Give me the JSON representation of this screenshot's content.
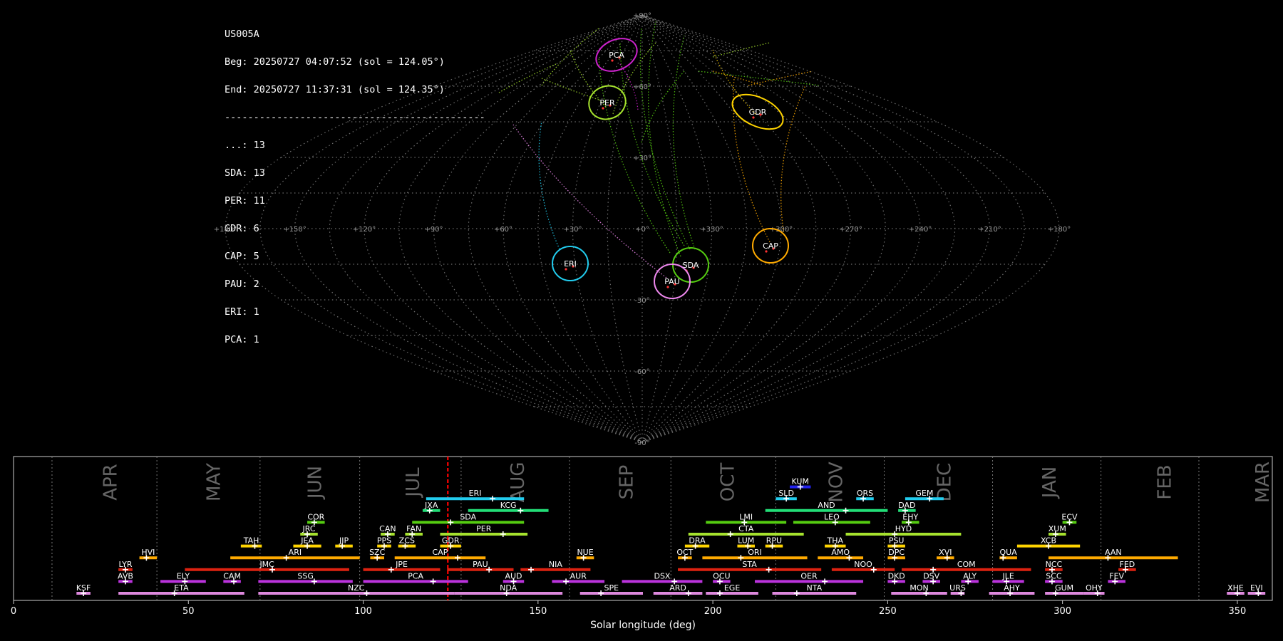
{
  "info_block": {
    "station": "US005A",
    "begin": "Beg: 20250727 04:07:52 (sol = 124.05°)",
    "end": "End: 20250727 11:37:31 (sol = 124.35°)",
    "separator": "---------------------------------------------",
    "counts": [
      {
        "label": "...: 13"
      },
      {
        "label": "SDA: 13"
      },
      {
        "label": "PER: 11"
      },
      {
        "label": "GDR: 6"
      },
      {
        "label": "CAP: 5"
      },
      {
        "label": "PAU: 2"
      },
      {
        "label": "ERI: 1"
      },
      {
        "label": "PCA: 1"
      }
    ]
  },
  "sky_map": {
    "projection": "sinusoidal",
    "lon_tick_labels": [
      "+180°",
      "+150°",
      "+120°",
      "+90°",
      "+60°",
      "+30°",
      "+0°",
      "+330°",
      "+300°",
      "+270°",
      "+240°",
      "+210°",
      "+180°"
    ],
    "lat_tick_labels": [
      "+90°",
      "+60°",
      "+30°",
      "-30°",
      "-60°",
      "-90°"
    ],
    "radiants": [
      {
        "name": "PCA",
        "color": "#cc22cc",
        "lon": -30,
        "lat": 71
      },
      {
        "name": "PER",
        "color": "#a6e22e",
        "lon": -45,
        "lat": 57
      },
      {
        "name": "GDR",
        "color": "#ffd400",
        "lon": -270,
        "lat": 51
      },
      {
        "name": "ERI",
        "color": "#22ccee",
        "lon": -105,
        "lat": -10
      },
      {
        "name": "SDA",
        "color": "#55cc11",
        "lon": -40,
        "lat": -12
      },
      {
        "name": "CAP",
        "color": "#ffaa00",
        "lon": -120,
        "lat": -5
      },
      {
        "name": "PAU",
        "color": "#ee88ee",
        "lon": -35,
        "lat": -17
      }
    ]
  },
  "chart_data": {
    "type": "timeline",
    "xlabel": "Solar longitude (deg)",
    "xlim": [
      0,
      360
    ],
    "x_ticks": [
      0,
      50,
      100,
      150,
      200,
      250,
      300,
      350
    ],
    "current_sol": 124.2,
    "months": [
      {
        "label": "APR",
        "center": 24.5,
        "start": 11
      },
      {
        "label": "MAY",
        "center": 54,
        "start": 41
      },
      {
        "label": "JUN",
        "center": 83,
        "start": 70.5
      },
      {
        "label": "JUL",
        "center": 111,
        "start": 99
      },
      {
        "label": "AUG",
        "center": 141,
        "start": 128
      },
      {
        "label": "SEP",
        "center": 172,
        "start": 159
      },
      {
        "label": "OCT",
        "center": 201,
        "start": 188
      },
      {
        "label": "NOV",
        "center": 232,
        "start": 218
      },
      {
        "label": "DEC",
        "center": 263,
        "start": 249
      },
      {
        "label": "JAN",
        "center": 293,
        "start": 280
      },
      {
        "label": "FEB",
        "center": 326,
        "start": 311
      },
      {
        "label": "MAR",
        "center": 354,
        "start": 339
      }
    ],
    "showers": [
      {
        "name": "KSF",
        "start": 18,
        "end": 22,
        "peak": 20,
        "row": 0,
        "color": "#dd88dd"
      },
      {
        "name": "ETA",
        "start": 30,
        "end": 66,
        "peak": 46,
        "row": 0,
        "color": "#dd88dd"
      },
      {
        "name": "NZC",
        "start": 70,
        "end": 126,
        "peak": 101,
        "row": 0,
        "color": "#dd88dd"
      },
      {
        "name": "NDA",
        "start": 126,
        "end": 157,
        "peak": 141,
        "row": 0,
        "color": "#dd88dd"
      },
      {
        "name": "SPE",
        "start": 162,
        "end": 180,
        "peak": 168,
        "row": 0,
        "color": "#dd88dd"
      },
      {
        "name": "ARD",
        "start": 183,
        "end": 197,
        "peak": 193,
        "row": 0,
        "color": "#dd88dd"
      },
      {
        "name": "EGE",
        "start": 198,
        "end": 213,
        "peak": 202,
        "row": 0,
        "color": "#dd88dd"
      },
      {
        "name": "NTA",
        "start": 217,
        "end": 241,
        "peak": 224,
        "row": 0,
        "color": "#dd88dd"
      },
      {
        "name": "MON",
        "start": 251,
        "end": 267,
        "peak": 261,
        "row": 0,
        "color": "#dd88dd"
      },
      {
        "name": "URS",
        "start": 268,
        "end": 272,
        "peak": 271,
        "row": 0,
        "color": "#dd88dd"
      },
      {
        "name": "AHY",
        "start": 279,
        "end": 292,
        "peak": 285,
        "row": 0,
        "color": "#dd88dd"
      },
      {
        "name": "GUM",
        "start": 295,
        "end": 306,
        "peak": 298,
        "row": 0,
        "color": "#dd88dd"
      },
      {
        "name": "OHY",
        "start": 306,
        "end": 312,
        "peak": 310,
        "row": 0,
        "color": "#dd88dd"
      },
      {
        "name": "XHE",
        "start": 347,
        "end": 352,
        "peak": 350,
        "row": 0,
        "color": "#dd88dd"
      },
      {
        "name": "EVI",
        "start": 353,
        "end": 358,
        "peak": 356,
        "row": 0,
        "color": "#dd88dd"
      },
      {
        "name": "AVB",
        "start": 30,
        "end": 34,
        "peak": 32,
        "row": 1,
        "color": "#bb33dd"
      },
      {
        "name": "ELY",
        "start": 42,
        "end": 55,
        "peak": 49,
        "row": 1,
        "color": "#bb33dd"
      },
      {
        "name": "CAM",
        "start": 60,
        "end": 65,
        "peak": 63,
        "row": 1,
        "color": "#bb33dd"
      },
      {
        "name": "SSG",
        "start": 70,
        "end": 97,
        "peak": 86,
        "row": 1,
        "color": "#bb33dd"
      },
      {
        "name": "PCA",
        "start": 100,
        "end": 130,
        "peak": 120,
        "row": 1,
        "color": "#bb33dd"
      },
      {
        "name": "AUD",
        "start": 140,
        "end": 146,
        "peak": 143,
        "row": 1,
        "color": "#bb33dd"
      },
      {
        "name": "AUR",
        "start": 154,
        "end": 169,
        "peak": 158,
        "row": 1,
        "color": "#bb33dd"
      },
      {
        "name": "DSX",
        "start": 174,
        "end": 197,
        "peak": 189,
        "row": 1,
        "color": "#bb33dd"
      },
      {
        "name": "OCU",
        "start": 200,
        "end": 205,
        "peak": 202,
        "row": 1,
        "color": "#bb33dd"
      },
      {
        "name": "OER",
        "start": 212,
        "end": 243,
        "peak": 232,
        "row": 1,
        "color": "#bb33dd"
      },
      {
        "name": "DKD",
        "start": 250,
        "end": 255,
        "peak": 252,
        "row": 1,
        "color": "#bb33dd"
      },
      {
        "name": "DSV",
        "start": 260,
        "end": 265,
        "peak": 263,
        "row": 1,
        "color": "#bb33dd"
      },
      {
        "name": "ALY",
        "start": 271,
        "end": 276,
        "peak": 273,
        "row": 1,
        "color": "#bb33dd"
      },
      {
        "name": "JLE",
        "start": 280,
        "end": 289,
        "peak": 284,
        "row": 1,
        "color": "#bb33dd"
      },
      {
        "name": "SCC",
        "start": 295,
        "end": 300,
        "peak": 297,
        "row": 1,
        "color": "#bb33dd"
      },
      {
        "name": "FEV",
        "start": 313,
        "end": 318,
        "peak": 315,
        "row": 1,
        "color": "#bb33dd"
      },
      {
        "name": "LYR",
        "start": 30,
        "end": 34,
        "peak": 32,
        "row": 2,
        "color": "#dd2211"
      },
      {
        "name": "JMC",
        "start": 49,
        "end": 96,
        "peak": 74,
        "row": 2,
        "color": "#dd2211"
      },
      {
        "name": "JPE",
        "start": 100,
        "end": 122,
        "peak": 108,
        "row": 2,
        "color": "#dd2211"
      },
      {
        "name": "PAU",
        "start": 124,
        "end": 143,
        "peak": 136,
        "row": 2,
        "color": "#dd2211"
      },
      {
        "name": "NIA",
        "start": 145,
        "end": 165,
        "peak": 148,
        "row": 2,
        "color": "#dd2211"
      },
      {
        "name": "STA",
        "start": 190,
        "end": 231,
        "peak": 216,
        "row": 2,
        "color": "#dd2211"
      },
      {
        "name": "NOO",
        "start": 234,
        "end": 252,
        "peak": 246,
        "row": 2,
        "color": "#dd2211"
      },
      {
        "name": "COM",
        "start": 254,
        "end": 291,
        "peak": 263,
        "row": 2,
        "color": "#dd2211"
      },
      {
        "name": "NCC",
        "start": 295,
        "end": 300,
        "peak": 297,
        "row": 2,
        "color": "#dd2211"
      },
      {
        "name": "FED",
        "start": 316,
        "end": 321,
        "peak": 318,
        "row": 2,
        "color": "#dd2211"
      },
      {
        "name": "HVI",
        "start": 36,
        "end": 41,
        "peak": 38,
        "row": 3,
        "color": "#ffaa00"
      },
      {
        "name": "ARI",
        "start": 62,
        "end": 99,
        "peak": 78,
        "row": 3,
        "color": "#ffaa00"
      },
      {
        "name": "SZC",
        "start": 102,
        "end": 106,
        "peak": 104,
        "row": 3,
        "color": "#ffaa00"
      },
      {
        "name": "CAP",
        "start": 109,
        "end": 135,
        "peak": 127,
        "row": 3,
        "color": "#ffaa00"
      },
      {
        "name": "NUE",
        "start": 161,
        "end": 166,
        "peak": 163,
        "row": 3,
        "color": "#ffaa00"
      },
      {
        "name": "OCT",
        "start": 190,
        "end": 194,
        "peak": 192,
        "row": 3,
        "color": "#ffaa00"
      },
      {
        "name": "ORI",
        "start": 197,
        "end": 227,
        "peak": 208,
        "row": 3,
        "color": "#ffaa00"
      },
      {
        "name": "AMO",
        "start": 230,
        "end": 243,
        "peak": 239,
        "row": 3,
        "color": "#ffaa00"
      },
      {
        "name": "DPC",
        "start": 250,
        "end": 255,
        "peak": 252,
        "row": 3,
        "color": "#ffaa00"
      },
      {
        "name": "XVI",
        "start": 264,
        "end": 269,
        "peak": 267,
        "row": 3,
        "color": "#ffaa00"
      },
      {
        "name": "QUA",
        "start": 282,
        "end": 287,
        "peak": 283,
        "row": 3,
        "color": "#ffaa00"
      },
      {
        "name": "AAN",
        "start": 296,
        "end": 333,
        "peak": 313,
        "row": 3,
        "color": "#ffaa00"
      },
      {
        "name": "TAH",
        "start": 65,
        "end": 71,
        "peak": 69,
        "row": 4,
        "color": "#ffd400"
      },
      {
        "name": "JEA",
        "start": 80,
        "end": 88,
        "peak": 84,
        "row": 4,
        "color": "#ffd400"
      },
      {
        "name": "JIP",
        "start": 92,
        "end": 97,
        "peak": 94,
        "row": 4,
        "color": "#ffd400"
      },
      {
        "name": "PPS",
        "start": 104,
        "end": 108,
        "peak": 106,
        "row": 4,
        "color": "#ffd400"
      },
      {
        "name": "ZCS",
        "start": 110,
        "end": 115,
        "peak": 112,
        "row": 4,
        "color": "#ffd400"
      },
      {
        "name": "GDR",
        "start": 122,
        "end": 128,
        "peak": 125,
        "row": 4,
        "color": "#ffd400"
      },
      {
        "name": "DRA",
        "start": 192,
        "end": 199,
        "peak": 195,
        "row": 4,
        "color": "#ffd400"
      },
      {
        "name": "LUM",
        "start": 207,
        "end": 212,
        "peak": 210,
        "row": 4,
        "color": "#ffd400"
      },
      {
        "name": "RPU",
        "start": 215,
        "end": 220,
        "peak": 217,
        "row": 4,
        "color": "#ffd400"
      },
      {
        "name": "THA",
        "start": 232,
        "end": 238,
        "peak": 235,
        "row": 4,
        "color": "#ffd400"
      },
      {
        "name": "PSU",
        "start": 250,
        "end": 255,
        "peak": 252,
        "row": 4,
        "color": "#ffd400"
      },
      {
        "name": "XCB",
        "start": 287,
        "end": 305,
        "peak": 296,
        "row": 4,
        "color": "#ffd400"
      },
      {
        "name": "JRC",
        "start": 82,
        "end": 87,
        "peak": 84,
        "row": 5,
        "color": "#a6e22e"
      },
      {
        "name": "CAN",
        "start": 105,
        "end": 109,
        "peak": 107,
        "row": 5,
        "color": "#a6e22e"
      },
      {
        "name": "FAN",
        "start": 112,
        "end": 117,
        "peak": 114,
        "row": 5,
        "color": "#a6e22e"
      },
      {
        "name": "PER",
        "start": 122,
        "end": 147,
        "peak": 140,
        "row": 5,
        "color": "#a6e22e"
      },
      {
        "name": "CTA",
        "start": 193,
        "end": 226,
        "peak": 205,
        "row": 5,
        "color": "#a6e22e"
      },
      {
        "name": "HYD",
        "start": 238,
        "end": 271,
        "peak": 252,
        "row": 5,
        "color": "#a6e22e"
      },
      {
        "name": "XUM",
        "start": 296,
        "end": 301,
        "peak": 298,
        "row": 5,
        "color": "#a6e22e"
      },
      {
        "name": "COR",
        "start": 84,
        "end": 89,
        "peak": 86,
        "row": 6,
        "color": "#55cc11"
      },
      {
        "name": "SDA",
        "start": 114,
        "end": 146,
        "peak": 125,
        "row": 6,
        "color": "#55cc11"
      },
      {
        "name": "LMI",
        "start": 198,
        "end": 221,
        "peak": 209,
        "row": 6,
        "color": "#55cc11"
      },
      {
        "name": "LEO",
        "start": 223,
        "end": 245,
        "peak": 235,
        "row": 6,
        "color": "#55cc11"
      },
      {
        "name": "EHY",
        "start": 254,
        "end": 259,
        "peak": 256,
        "row": 6,
        "color": "#55cc11"
      },
      {
        "name": "ECV",
        "start": 300,
        "end": 304,
        "peak": 302,
        "row": 6,
        "color": "#55cc11"
      },
      {
        "name": "JXA",
        "start": 117,
        "end": 122,
        "peak": 119,
        "row": 7,
        "color": "#22dd77"
      },
      {
        "name": "KCG",
        "start": 130,
        "end": 153,
        "peak": 145,
        "row": 7,
        "color": "#22dd77"
      },
      {
        "name": "AND",
        "start": 215,
        "end": 250,
        "peak": 238,
        "row": 7,
        "color": "#22dd77"
      },
      {
        "name": "DAD",
        "start": 253,
        "end": 258,
        "peak": 255,
        "row": 7,
        "color": "#22dd77"
      },
      {
        "name": "ERI",
        "start": 118,
        "end": 146,
        "peak": 137,
        "row": 8,
        "color": "#22ccee"
      },
      {
        "name": "SLD",
        "start": 218,
        "end": 224,
        "peak": 221,
        "row": 8,
        "color": "#22ccee"
      },
      {
        "name": "ORS",
        "start": 241,
        "end": 246,
        "peak": 243,
        "row": 8,
        "color": "#22ccee"
      },
      {
        "name": "GEM",
        "start": 255,
        "end": 266,
        "peak": 262,
        "row": 8,
        "color": "#22ccee"
      },
      {
        "name": "KUM",
        "start": 222,
        "end": 228,
        "peak": 225,
        "row": 9,
        "color": "#2222ee"
      }
    ]
  },
  "colors": {
    "background": "#000000",
    "grid": "#888888",
    "current_sol_line": "#ff0000",
    "month_text": "#666666",
    "axis_text": "#ffffff"
  }
}
